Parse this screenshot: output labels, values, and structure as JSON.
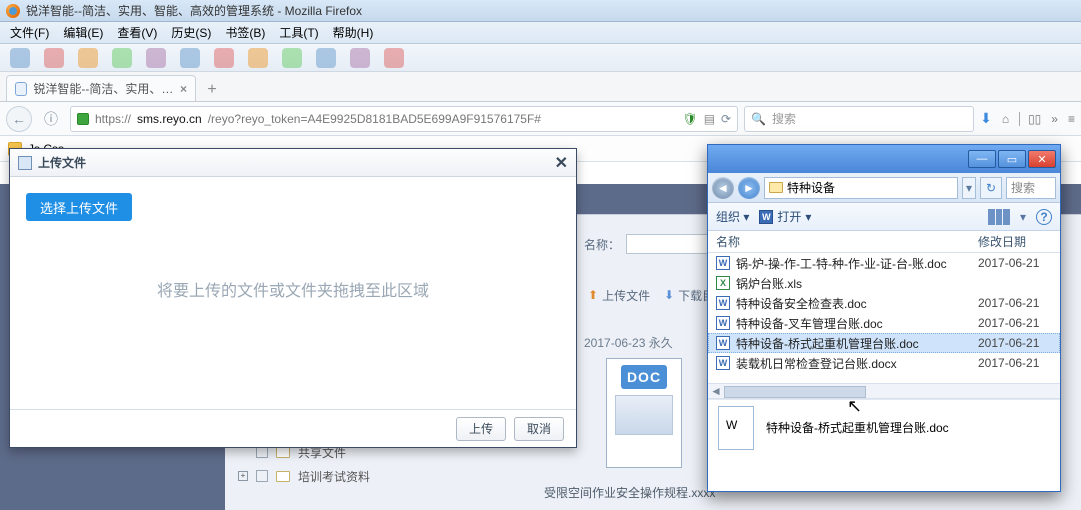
{
  "firefox": {
    "window_title": "锐洋智能--简洁、实用、智能、高效的管理系统 - Mozilla Firefox",
    "menus": [
      "文件(F)",
      "编辑(E)",
      "查看(V)",
      "历史(S)",
      "书签(B)",
      "工具(T)",
      "帮助(H)"
    ],
    "tab_title": "锐洋智能--简洁、实用、智能...",
    "url": "https://sms.reyo.cn/reyo?reyo_token=A4E9925D8181BAD5E699A9F91576175F#",
    "url_host": "sms.reyo.cn",
    "url_path": "/reyo?reyo_token=A4E9925D8181BAD5E699A9F91576175F#",
    "search_placeholder": "搜索",
    "bookmark": "Js Css"
  },
  "modal": {
    "title": "上传文件",
    "choose_btn": "选择上传文件",
    "dropzone": "将要上传的文件或文件夹拖拽至此区域",
    "ok": "上传",
    "cancel": "取消"
  },
  "bg": {
    "name_label": "名称：",
    "upload_btn": "上传文件",
    "download_btn": "下载目录",
    "meta": "2017-06-23  永久",
    "sidebar": {
      "shared": "共享文件",
      "training": "培训考试资料"
    },
    "caption": "受限空间作业安全操作规程.xxxx"
  },
  "explorer": {
    "breadcrumb": "特种设备",
    "search_placeholder": "搜索",
    "toolbar": {
      "organize": "组织",
      "open": "打开"
    },
    "columns": {
      "name": "名称",
      "mdate": "修改日期"
    },
    "files": [
      {
        "icon": "doc",
        "name": "锅-炉-操-作-工-特-种-作-业-证-台-账.doc",
        "date": "2017-06-21"
      },
      {
        "icon": "xls",
        "name": "锅炉台账.xls",
        "date": ""
      },
      {
        "icon": "doc",
        "name": "特种设备安全检查表.doc",
        "date": "2017-06-21"
      },
      {
        "icon": "doc",
        "name": "特种设备-叉车管理台账.doc",
        "date": "2017-06-21"
      },
      {
        "icon": "doc",
        "name": "特种设备-桥式起重机管理台账.doc",
        "date": "2017-06-21",
        "selected": true
      },
      {
        "icon": "doc",
        "name": "装载机日常检查登记台账.docx",
        "date": "2017-06-21"
      }
    ],
    "selected_name": "特种设备-桥式起重机管理台账.doc"
  }
}
